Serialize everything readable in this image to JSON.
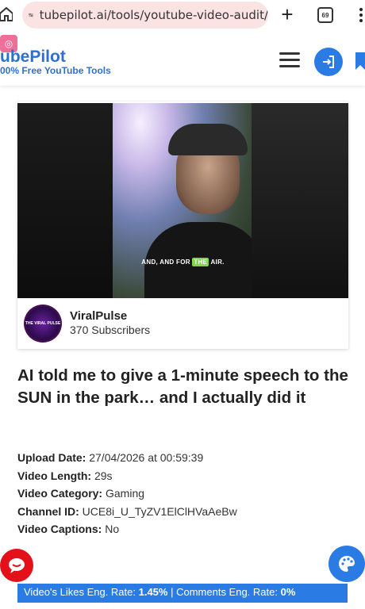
{
  "browser": {
    "url": "tubepilot.ai/tools/youtube-video-audit/",
    "tab_count": "69",
    "plus_icon": "plus-icon",
    "more_icon": "more-vertical-icon"
  },
  "site": {
    "logo_prefix": "Tube",
    "logo_accent": "Pilot",
    "logo_visible": "ubePilot",
    "tagline": "00% Free YouTube Tools",
    "brand_color": "#2f6fcf",
    "accent_color": "#2b7be4"
  },
  "video": {
    "caption_before": "AND, AND FOR ",
    "caption_highlight": "THE",
    "caption_after": " AIR.",
    "channel_name": "ViralPulse",
    "subscribers": "370 Subscribers",
    "avatar_text": "THE VIRAL PULSE",
    "title": "AI told me to give a 1-minute speech to the SUN in the park… and I actually did it"
  },
  "meta": {
    "upload_label": "Upload Date:",
    "upload_value": " 27/04/2026 at 00:59:39",
    "length_label": "Video Length:",
    "length_value": " 29s",
    "category_label": "Video Category:",
    "category_value": " Gaming",
    "channel_id_label": "Channel ID:",
    "channel_id_value": " UCE8i_U_TyZV1ElClHVaAeBw",
    "captions_label": "Video Captions:",
    "captions_value": " No"
  },
  "engagement": {
    "likes_label": "Video's Likes Eng. Rate: ",
    "likes_value": "1.45%",
    "separator": " | ",
    "comments_label": "Comments Eng. Rate: ",
    "comments_value": "0%"
  }
}
